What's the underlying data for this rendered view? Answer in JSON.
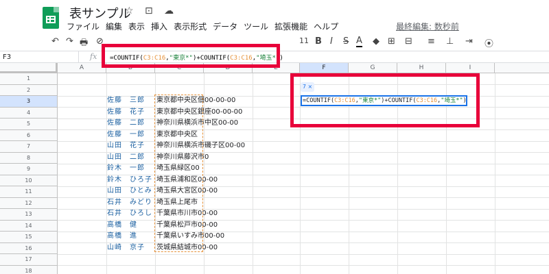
{
  "app": {
    "doc_title": "表サンプル",
    "title_icons": "☆ ⊡ ☁",
    "last_edit": "最終編集: 数秒前"
  },
  "menu": [
    "ファイル",
    "編集",
    "表示",
    "挿入",
    "表示形式",
    "データ",
    "ツール",
    "拡張機能",
    "ヘルプ"
  ],
  "toolbar": {
    "undo": "↶",
    "redo": "↷",
    "print": "🖶",
    "paint": "⊘",
    "font_size": "11",
    "bold": "B",
    "italic": "I",
    "strike": "S",
    "text_color": "A",
    "fill": "◆",
    "borders": "⊞",
    "merge": "⊟",
    "align": "≡",
    "valign": "⊥",
    "wrap": "⇥",
    "rotate": "⦿"
  },
  "formula_bar": {
    "cell_ref": "F3",
    "fx": "fx",
    "formula": {
      "p1": "=COUNTIF(",
      "r1": "C3:C16",
      "p2": ",",
      "s1": "\"東京*\"",
      "p3": ")+COUNTIF(",
      "r2": "C3:C16",
      "p4": ",",
      "s2": "\"埼玉*\"",
      "p5": ")"
    }
  },
  "grid": {
    "columns": [
      "A",
      "B",
      "C",
      "D",
      "E",
      "F",
      "G",
      "H",
      "I"
    ],
    "rows": [
      "1",
      "2",
      "3",
      "4",
      "5",
      "6",
      "7",
      "8",
      "9",
      "10",
      "11",
      "12",
      "13",
      "14",
      "15",
      "16",
      "17",
      "18"
    ],
    "names": [
      "佐藤　三郎",
      "佐藤　花子",
      "佐藤　二郎",
      "佐藤　一郎",
      "山田　花子",
      "山田　二郎",
      "鈴木　一郎",
      "鈴木　ひろ子",
      "山田　ひとみ",
      "石井　みどり",
      "石井　ひろし",
      "高橋　健",
      "高橋　進",
      "山崎　京子"
    ],
    "addresses": [
      "東京都中央区佃00-00-00",
      "東京都中央区銀座00-00-00",
      "神奈川県横浜市中区00-00",
      "東京都中央区",
      "神奈川県横浜市磯子区00-00",
      "神奈川県藤沢市0",
      "埼玉県緑区00",
      "埼玉県浦和区00-00",
      "埼玉県大宮区00-00",
      "埼玉県上尾市",
      "千葉県市川市00-00",
      "千葉県松戸市00-00",
      "千葉県いすみ市00-00",
      "茨城県結城市00-00"
    ]
  },
  "editor": {
    "chip": "7 ×",
    "formula": {
      "p1": "=COUNTIF(",
      "r1": "C3:C16",
      "p2": ",",
      "s1": "\"東京*\"",
      "p3": ")+COUNTIF(",
      "r2": "C3:C16",
      "p4": ",",
      "s2": "\"埼玉*\"",
      "p5": ")"
    }
  },
  "colors": {
    "highlight_red": "#e8003a",
    "range_orange": "#e69138",
    "string_green": "#188038",
    "selection_blue": "#1a73e8"
  }
}
